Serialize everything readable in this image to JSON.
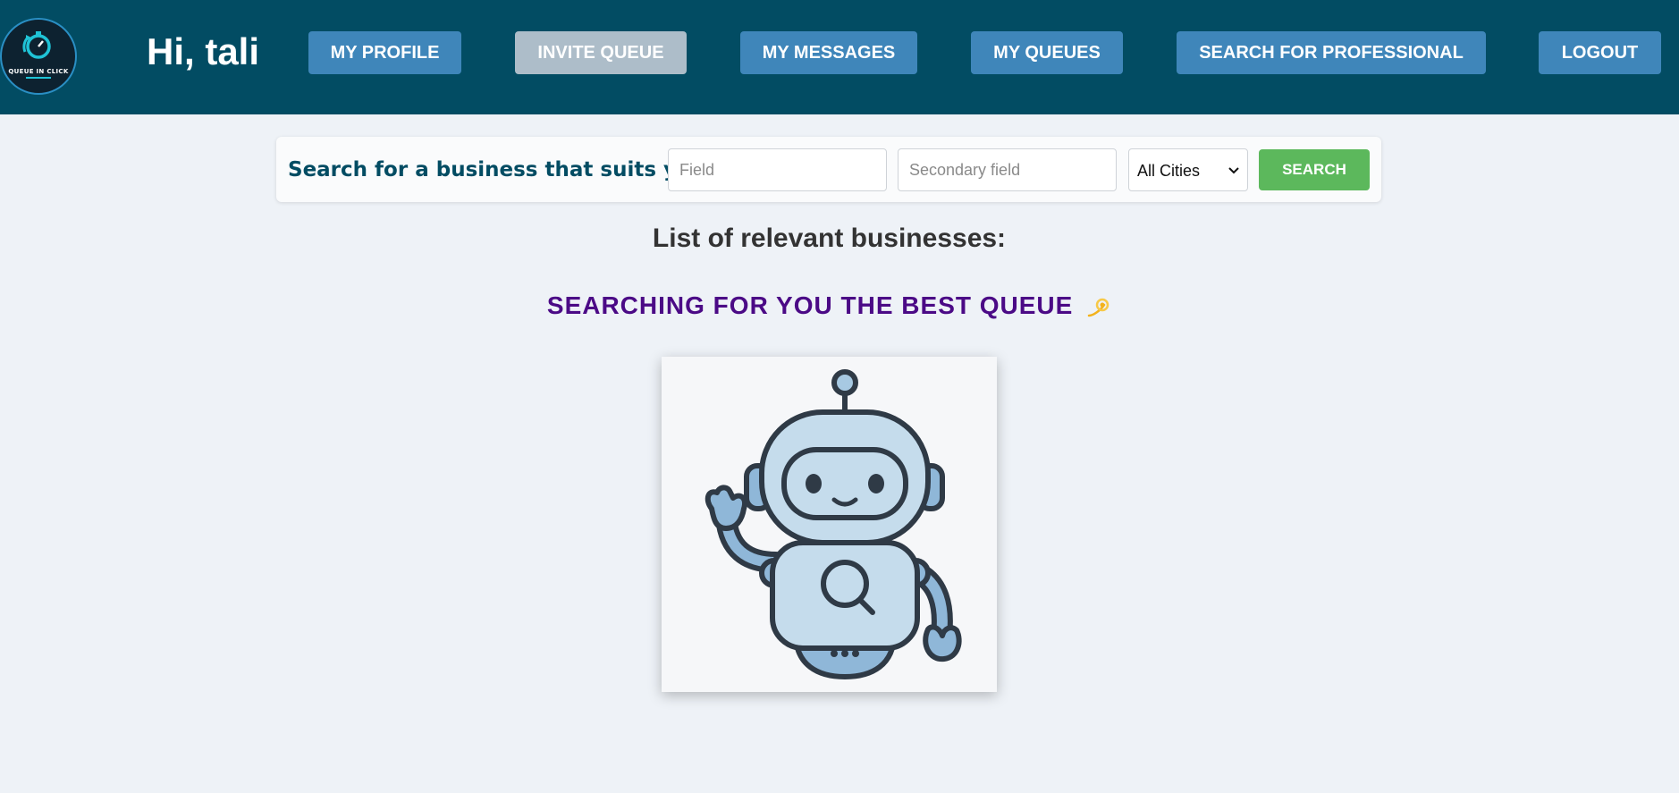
{
  "header": {
    "logo_text": "QUEUE IN CLICK",
    "greeting": "Hi, tali",
    "nav": {
      "my_profile": "MY PROFILE",
      "invite_queue": "INVITE QUEUE",
      "my_messages": "MY MESSAGES",
      "my_queues": "MY QUEUES",
      "search_professional": "SEARCH FOR PROFESSIONAL",
      "logout": "LOGOUT"
    },
    "active_tab": "invite_queue"
  },
  "search": {
    "label": "Search for a business that suits you:",
    "field_placeholder": "Field",
    "field_value": "",
    "secondary_placeholder": "Secondary field",
    "secondary_value": "",
    "city_selected": "All Cities",
    "button_label": "SEARCH"
  },
  "main": {
    "list_heading": "List of relevant businesses:",
    "searching_text": "SEARCHING FOR YOU THE BEST QUEUE",
    "searching_icon": "dizzy-icon",
    "image_icon": "robot-searching-icon"
  },
  "colors": {
    "header_bg": "#024c63",
    "nav_button": "#3f86ba",
    "nav_button_active": "#adbdc9",
    "search_button": "#5cb85c",
    "searching_text": "#4b0a86",
    "page_bg": "#eef2f7"
  }
}
